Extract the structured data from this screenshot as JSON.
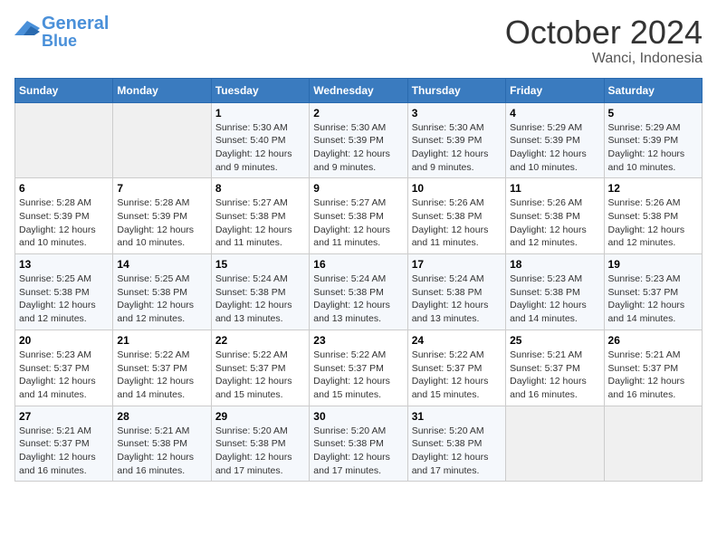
{
  "header": {
    "logo_general": "General",
    "logo_blue": "Blue",
    "month": "October 2024",
    "location": "Wanci, Indonesia"
  },
  "columns": [
    "Sunday",
    "Monday",
    "Tuesday",
    "Wednesday",
    "Thursday",
    "Friday",
    "Saturday"
  ],
  "weeks": [
    [
      {
        "num": "",
        "info": ""
      },
      {
        "num": "",
        "info": ""
      },
      {
        "num": "1",
        "info": "Sunrise: 5:30 AM\nSunset: 5:40 PM\nDaylight: 12 hours and 9 minutes."
      },
      {
        "num": "2",
        "info": "Sunrise: 5:30 AM\nSunset: 5:39 PM\nDaylight: 12 hours and 9 minutes."
      },
      {
        "num": "3",
        "info": "Sunrise: 5:30 AM\nSunset: 5:39 PM\nDaylight: 12 hours and 9 minutes."
      },
      {
        "num": "4",
        "info": "Sunrise: 5:29 AM\nSunset: 5:39 PM\nDaylight: 12 hours and 10 minutes."
      },
      {
        "num": "5",
        "info": "Sunrise: 5:29 AM\nSunset: 5:39 PM\nDaylight: 12 hours and 10 minutes."
      }
    ],
    [
      {
        "num": "6",
        "info": "Sunrise: 5:28 AM\nSunset: 5:39 PM\nDaylight: 12 hours and 10 minutes."
      },
      {
        "num": "7",
        "info": "Sunrise: 5:28 AM\nSunset: 5:39 PM\nDaylight: 12 hours and 10 minutes."
      },
      {
        "num": "8",
        "info": "Sunrise: 5:27 AM\nSunset: 5:38 PM\nDaylight: 12 hours and 11 minutes."
      },
      {
        "num": "9",
        "info": "Sunrise: 5:27 AM\nSunset: 5:38 PM\nDaylight: 12 hours and 11 minutes."
      },
      {
        "num": "10",
        "info": "Sunrise: 5:26 AM\nSunset: 5:38 PM\nDaylight: 12 hours and 11 minutes."
      },
      {
        "num": "11",
        "info": "Sunrise: 5:26 AM\nSunset: 5:38 PM\nDaylight: 12 hours and 12 minutes."
      },
      {
        "num": "12",
        "info": "Sunrise: 5:26 AM\nSunset: 5:38 PM\nDaylight: 12 hours and 12 minutes."
      }
    ],
    [
      {
        "num": "13",
        "info": "Sunrise: 5:25 AM\nSunset: 5:38 PM\nDaylight: 12 hours and 12 minutes."
      },
      {
        "num": "14",
        "info": "Sunrise: 5:25 AM\nSunset: 5:38 PM\nDaylight: 12 hours and 12 minutes."
      },
      {
        "num": "15",
        "info": "Sunrise: 5:24 AM\nSunset: 5:38 PM\nDaylight: 12 hours and 13 minutes."
      },
      {
        "num": "16",
        "info": "Sunrise: 5:24 AM\nSunset: 5:38 PM\nDaylight: 12 hours and 13 minutes."
      },
      {
        "num": "17",
        "info": "Sunrise: 5:24 AM\nSunset: 5:38 PM\nDaylight: 12 hours and 13 minutes."
      },
      {
        "num": "18",
        "info": "Sunrise: 5:23 AM\nSunset: 5:38 PM\nDaylight: 12 hours and 14 minutes."
      },
      {
        "num": "19",
        "info": "Sunrise: 5:23 AM\nSunset: 5:37 PM\nDaylight: 12 hours and 14 minutes."
      }
    ],
    [
      {
        "num": "20",
        "info": "Sunrise: 5:23 AM\nSunset: 5:37 PM\nDaylight: 12 hours and 14 minutes."
      },
      {
        "num": "21",
        "info": "Sunrise: 5:22 AM\nSunset: 5:37 PM\nDaylight: 12 hours and 14 minutes."
      },
      {
        "num": "22",
        "info": "Sunrise: 5:22 AM\nSunset: 5:37 PM\nDaylight: 12 hours and 15 minutes."
      },
      {
        "num": "23",
        "info": "Sunrise: 5:22 AM\nSunset: 5:37 PM\nDaylight: 12 hours and 15 minutes."
      },
      {
        "num": "24",
        "info": "Sunrise: 5:22 AM\nSunset: 5:37 PM\nDaylight: 12 hours and 15 minutes."
      },
      {
        "num": "25",
        "info": "Sunrise: 5:21 AM\nSunset: 5:37 PM\nDaylight: 12 hours and 16 minutes."
      },
      {
        "num": "26",
        "info": "Sunrise: 5:21 AM\nSunset: 5:37 PM\nDaylight: 12 hours and 16 minutes."
      }
    ],
    [
      {
        "num": "27",
        "info": "Sunrise: 5:21 AM\nSunset: 5:37 PM\nDaylight: 12 hours and 16 minutes."
      },
      {
        "num": "28",
        "info": "Sunrise: 5:21 AM\nSunset: 5:38 PM\nDaylight: 12 hours and 16 minutes."
      },
      {
        "num": "29",
        "info": "Sunrise: 5:20 AM\nSunset: 5:38 PM\nDaylight: 12 hours and 17 minutes."
      },
      {
        "num": "30",
        "info": "Sunrise: 5:20 AM\nSunset: 5:38 PM\nDaylight: 12 hours and 17 minutes."
      },
      {
        "num": "31",
        "info": "Sunrise: 5:20 AM\nSunset: 5:38 PM\nDaylight: 12 hours and 17 minutes."
      },
      {
        "num": "",
        "info": ""
      },
      {
        "num": "",
        "info": ""
      }
    ]
  ]
}
